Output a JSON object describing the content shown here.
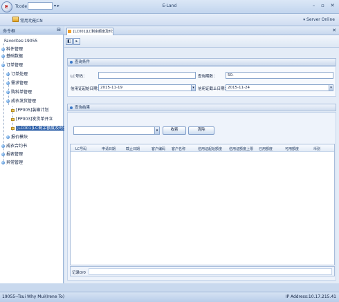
{
  "titlebar": {
    "tcode_label": "Tcode",
    "tcode_value": "",
    "app_title": "E-Land",
    "logo_text": "E",
    "dropdown_arrows": "▾ ▸",
    "minimize": "–",
    "maximize": "▫",
    "close": "✕"
  },
  "menubar": {
    "favorites_label": "常用功能CN",
    "server": "▾ Server Online"
  },
  "sidebar": {
    "title": "命令框",
    "pin": "⊟",
    "tree": [
      {
        "label": "Favorites:19055"
      },
      {
        "label": "料件管理"
      },
      {
        "label": "基础数据"
      },
      {
        "label": "订单管理"
      },
      {
        "label": "订单处理"
      },
      {
        "label": "需求管理"
      },
      {
        "label": "购料单管理"
      },
      {
        "label": "成衣发货管理"
      },
      {
        "label": "[PP005]装箱计划"
      },
      {
        "label": "[PP003]发货单开立"
      },
      {
        "label": "[LC001]LC剩余额度及时查询"
      },
      {
        "label": "报价模块"
      },
      {
        "label": "成衣合约书"
      },
      {
        "label": "报表管理"
      },
      {
        "label": "异常管理"
      }
    ]
  },
  "tab": {
    "label": "[LC001]LC剩余额度及时查询",
    "close": "✕"
  },
  "toolbar": {
    "btn1": "◧",
    "btn2": "▸"
  },
  "query": {
    "title": "查询条件",
    "lc_no_label": "LC号码：",
    "lc_no_value": "",
    "deadline_label": "查询期数：",
    "deadline_value": "50.",
    "start_label": "信用证起始日期：",
    "start_value": "2015-11-19",
    "end_label": "信用证截止日期：",
    "end_value": "2015-11-24",
    "dd": "▾"
  },
  "results": {
    "title": "查询结果",
    "select_value": "",
    "dd": "▾",
    "search_label": "收索",
    "clear_label": "清除",
    "columns": [
      "LC号码",
      "申请日期",
      "截止日期",
      "客户编码",
      "客户名称",
      "信用证起始额度",
      "信用证额度上限",
      "已用额度",
      "可用额度",
      "币别"
    ],
    "footer": "记录0/0"
  },
  "status": {
    "user": "19055--Tsui Why Mui(Irene To)",
    "ip": "IP Address:10.17.215.41"
  },
  "colors": {
    "accent": "#2c5fa8",
    "header_bg": "#c9d9ee"
  }
}
